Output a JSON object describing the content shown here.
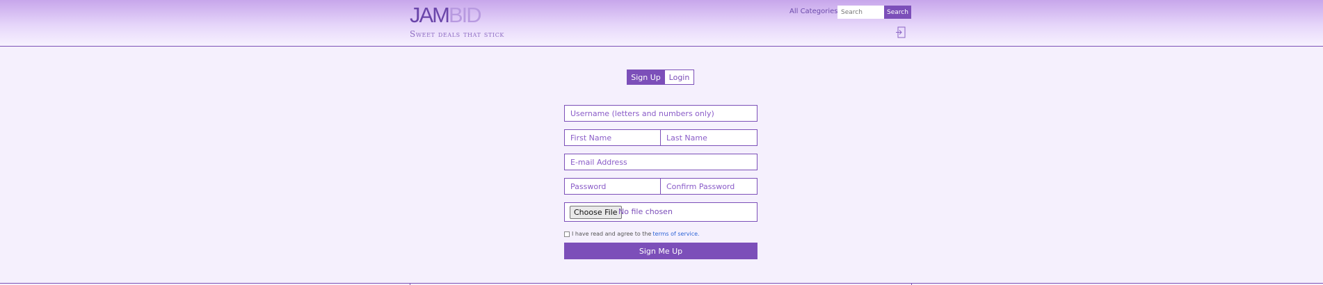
{
  "header": {
    "brand_part1": "JAM",
    "brand_part2": "BID",
    "tagline": "Sweet deals that stick",
    "all_categories": "All Categories",
    "search_placeholder": "Search",
    "search_button": "Search",
    "login_icon": "login-icon"
  },
  "tabs": [
    {
      "label": "Sign Up",
      "active": true
    },
    {
      "label": "Login",
      "active": false
    }
  ],
  "form": {
    "username_placeholder": "Username (letters and numbers only)",
    "first_name_placeholder": "First Name",
    "last_name_placeholder": "Last Name",
    "email_placeholder": "E-mail Address",
    "password_placeholder": "Password",
    "confirm_password_placeholder": "Confirm Password",
    "file_button": "Choose File",
    "file_status": "No file chosen",
    "terms_text": "I have read and agree to the",
    "terms_link": "terms of service.",
    "submit_label": "Sign Me Up"
  },
  "colors": {
    "accent": "#7c4fb9",
    "background": "#f5f0fd",
    "link": "#2c63d6"
  }
}
